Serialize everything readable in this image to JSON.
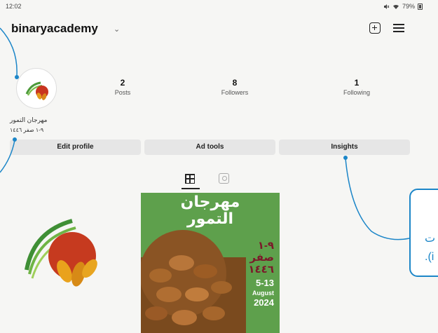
{
  "status_bar": {
    "time": "12:02",
    "battery": "79%"
  },
  "header": {
    "username": "binaryacademy"
  },
  "profile": {
    "bio_name": "مهرجان التمور",
    "bio_line": "٩-١ صفر ١٤٤٦",
    "stats": [
      {
        "value": "2",
        "label": "Posts"
      },
      {
        "value": "8",
        "label": "Followers"
      },
      {
        "value": "1",
        "label": "Following"
      }
    ]
  },
  "actions": {
    "edit_profile": "Edit profile",
    "ad_tools": "Ad tools",
    "insights": "Insights"
  },
  "posts": {
    "poster_title_1": "مهرجان",
    "poster_title_2": "التمور",
    "poster_date_1": "٩-١",
    "poster_date_2": "صفر",
    "poster_date_3": "١٤٤٦",
    "poster_days": "5-13",
    "poster_month": "August",
    "poster_year": "2024"
  },
  "callout": {
    "line_1": "ت",
    "line_2": "i)."
  },
  "colors": {
    "callout_blue": "#1c86c8",
    "poster_green": "#5ea04c",
    "button_gray": "#e6e6e6"
  }
}
